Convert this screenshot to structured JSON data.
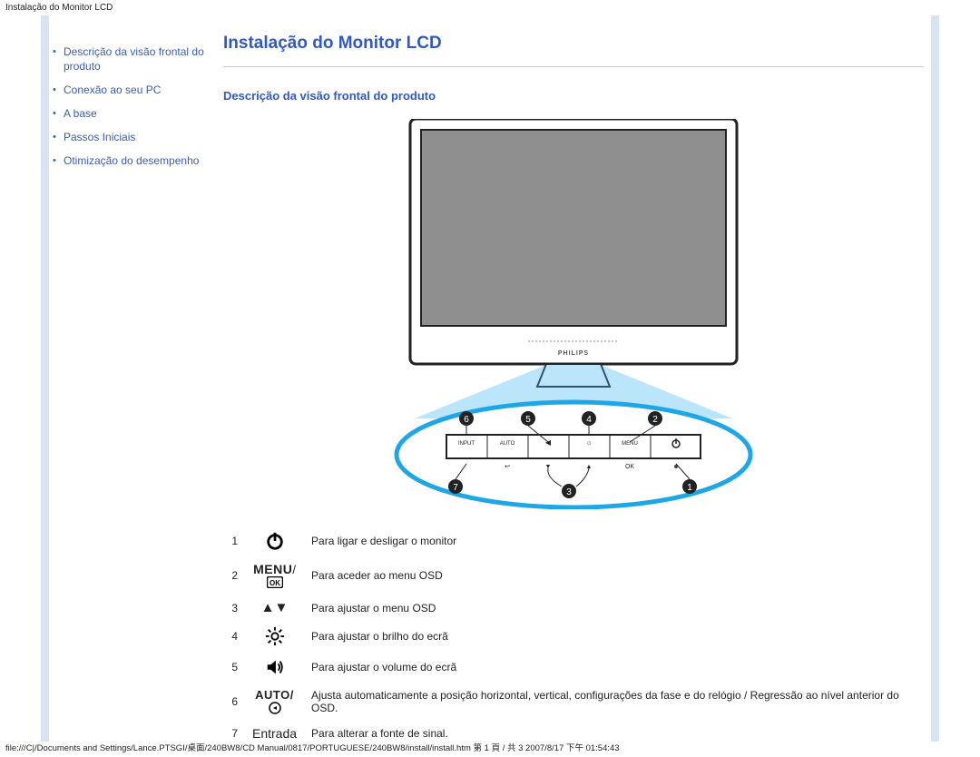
{
  "window_title": "Instalação do Monitor LCD",
  "sidebar": {
    "items": [
      {
        "label": "Descrição da visão frontal do produto"
      },
      {
        "label": "Conexão ao seu PC"
      },
      {
        "label": "A base"
      },
      {
        "label": "Passos Iniciais"
      },
      {
        "label": "Otimização do desempenho"
      }
    ]
  },
  "main": {
    "title": "Instalação do Monitor LCD",
    "section_title": "Descrição da visão frontal do produto"
  },
  "diagram": {
    "brand": "PHILIPS",
    "buttons": [
      "INPUT",
      "AUTO",
      "",
      "",
      "MENU",
      ""
    ],
    "callouts_top": [
      "6",
      "5",
      "4",
      "2"
    ],
    "callouts_bottom": [
      "7",
      "3",
      "1"
    ]
  },
  "legend": [
    {
      "num": "1",
      "icon": "power",
      "label": "",
      "desc": "Para ligar e desligar o monitor"
    },
    {
      "num": "2",
      "icon": "menu",
      "label": "MENU/",
      "desc": "Para aceder ao menu OSD"
    },
    {
      "num": "3",
      "icon": "updown",
      "label": "",
      "desc": "Para ajustar o menu OSD"
    },
    {
      "num": "4",
      "icon": "brightness",
      "label": "",
      "desc": "Para ajustar o brilho do ecrã"
    },
    {
      "num": "5",
      "icon": "volume",
      "label": "",
      "desc": "Para ajustar o volume do ecrã"
    },
    {
      "num": "6",
      "icon": "auto",
      "label": "AUTO/",
      "desc": "Ajusta automaticamente a posição horizontal, vertical, configurações da fase e do relógio / Regressão ao nível anterior do OSD."
    },
    {
      "num": "7",
      "icon": "entrada",
      "label": "Entrada",
      "desc": "Para alterar a fonte de sinal."
    }
  ],
  "footer": "file:///C|/Documents and Settings/Lance.PTSGI/桌面/240BW8/CD Manual/0817/PORTUGUESE/240BW8/install/install.htm 第 1 頁 / 共 3 2007/8/17 下午 01:54:43"
}
